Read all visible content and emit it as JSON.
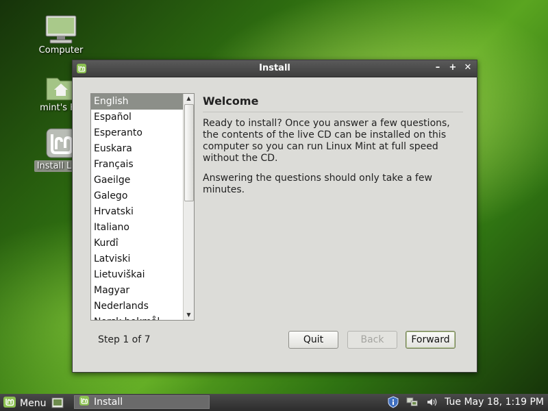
{
  "desktop": {
    "icons": [
      {
        "label": "Computer"
      },
      {
        "label": "mint's Ho"
      },
      {
        "label": "Install Linu"
      }
    ]
  },
  "window": {
    "title": "Install",
    "controls": {
      "minimize": "–",
      "maximize": "+",
      "close": "✕"
    }
  },
  "languages": {
    "selected": "English",
    "items": [
      "English",
      "Español",
      "Esperanto",
      "Euskara",
      "Français",
      "Gaeilge",
      "Galego",
      "Hrvatski",
      "Italiano",
      "Kurdî",
      "Latviski",
      "Lietuviškai",
      "Magyar",
      "Nederlands",
      "Norsk bokmål"
    ]
  },
  "welcome": {
    "heading": "Welcome",
    "para1": "Ready to install?  Once you answer a few questions, the contents of the live CD can be installed on this computer so you can run Linux Mint at full speed without the CD.",
    "para2": "Answering the questions should only take a few minutes."
  },
  "footer": {
    "step": "Step 1 of 7",
    "quit_label": "Quit",
    "back_label": "Back",
    "forward_label": "Forward"
  },
  "taskbar": {
    "menu_label": "Menu",
    "task_label": "Install",
    "datetime": "Tue May 18,  1:19 PM"
  },
  "colors": {
    "accent": "#6fb43a",
    "selection": "#8c8f89"
  }
}
